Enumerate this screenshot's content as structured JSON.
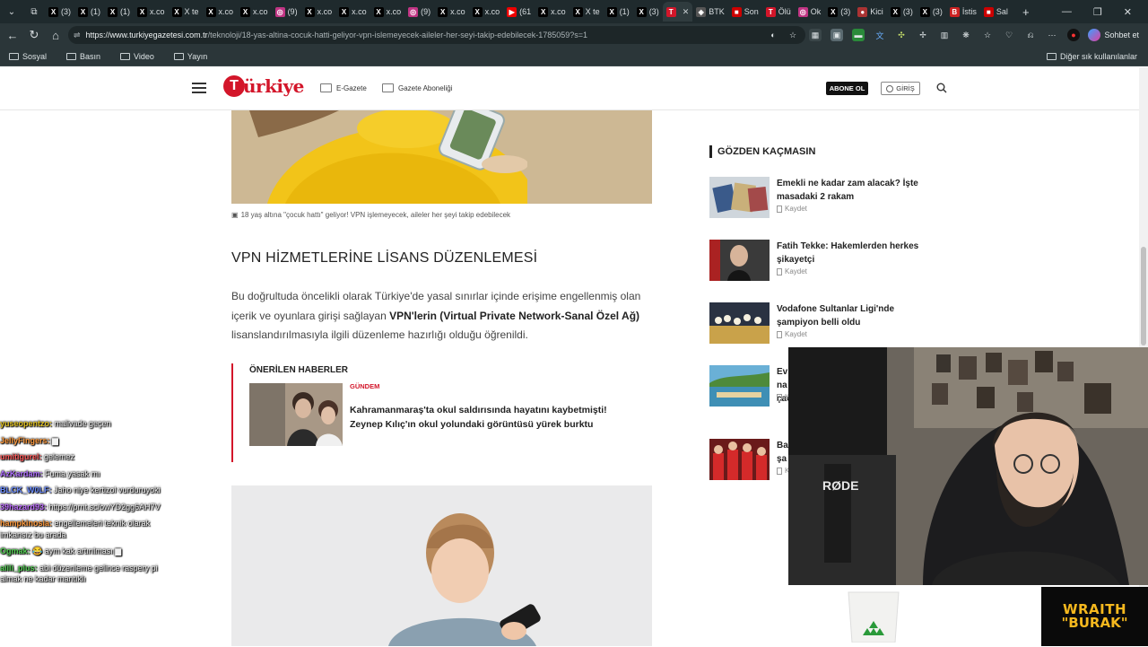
{
  "browser": {
    "tabs": [
      {
        "label": "(3)",
        "fav": "X",
        "color": "#000"
      },
      {
        "label": "(1)",
        "fav": "X",
        "color": "#000"
      },
      {
        "label": "(1)",
        "fav": "X",
        "color": "#000"
      },
      {
        "label": "x.co",
        "fav": "X",
        "color": "#000"
      },
      {
        "label": "X te",
        "fav": "X",
        "color": "#000"
      },
      {
        "label": "x.co",
        "fav": "X",
        "color": "#000"
      },
      {
        "label": "x.co",
        "fav": "X",
        "color": "#000"
      },
      {
        "label": "(9)",
        "fav": "◎",
        "color": "#c13584"
      },
      {
        "label": "x.co",
        "fav": "X",
        "color": "#000"
      },
      {
        "label": "x.co",
        "fav": "X",
        "color": "#000"
      },
      {
        "label": "x.co",
        "fav": "X",
        "color": "#000"
      },
      {
        "label": "(9)",
        "fav": "◎",
        "color": "#c13584"
      },
      {
        "label": "x.co",
        "fav": "X",
        "color": "#000"
      },
      {
        "label": "x.co",
        "fav": "X",
        "color": "#000"
      },
      {
        "label": "(61",
        "fav": "▶",
        "color": "#e00"
      },
      {
        "label": "x.co",
        "fav": "X",
        "color": "#000"
      },
      {
        "label": "X te",
        "fav": "X",
        "color": "#000"
      },
      {
        "label": "(1)",
        "fav": "X",
        "color": "#000"
      },
      {
        "label": "(3)",
        "fav": "X",
        "color": "#000"
      },
      {
        "label": "",
        "fav": "T",
        "color": "#d3162a",
        "active": true
      },
      {
        "label": "BTK",
        "fav": "◈",
        "color": "#555"
      },
      {
        "label": "Son",
        "fav": "■",
        "color": "#c00"
      },
      {
        "label": "Ölü",
        "fav": "T",
        "color": "#d3162a"
      },
      {
        "label": "Ok",
        "fav": "◎",
        "color": "#c13584"
      },
      {
        "label": "(3)",
        "fav": "X",
        "color": "#000"
      },
      {
        "label": "Kici",
        "fav": "●",
        "color": "#a33"
      },
      {
        "label": "(3)",
        "fav": "X",
        "color": "#000"
      },
      {
        "label": "(3)",
        "fav": "X",
        "color": "#000"
      },
      {
        "label": "İstis",
        "fav": "B",
        "color": "#c22"
      },
      {
        "label": "Sal",
        "fav": "■",
        "color": "#c00"
      }
    ],
    "url_host": "https://www.turkiyegazetesi.com.tr",
    "url_path": "/teknoloji/18-yas-altina-cocuk-hatti-geliyor-vpn-islemeyecek-aileler-her-seyi-takip-edebilecek-1785059?s=1",
    "sohbet_label": "Sohbet et",
    "bookmarks": [
      "Sosyal",
      "Basın",
      "Video",
      "Yayın"
    ],
    "other_bookmarks": "Diğer sık kullanılanlar"
  },
  "site": {
    "logo_text": "ürkiye",
    "logo_mark": "T",
    "egazete": "E-Gazete",
    "abonelik": "Gazete Aboneliği",
    "abone_button": "ABONE OL",
    "giris_button": "GİRİŞ"
  },
  "article": {
    "caption": "18 yaş altına \"çocuk hattı\" geliyor! VPN işlemeyecek, aileler her şeyi takip edebilecek",
    "section_heading": "VPN HİZMETLERİNE LİSANS DÜZENLEMESİ",
    "para_before": "Bu doğrultuda öncelikli olarak Türkiye'de yasal sınırlar içinde erişime engellenmiş olan içerik ve oyunlara girişi sağlayan ",
    "para_bold": "VPN'lerin (Virtual Private Network-Sanal Özel Ağ)",
    "para_after": " lisanslandırılmasıyla ilgili düzenleme hazırlığı olduğu öğrenildi.",
    "recommended": {
      "title": "ÖNERİLEN HABERLER",
      "category": "GÜNDEM",
      "headline": "Kahramanmaraş'ta okul saldırısında hayatını kaybetmişti! Zeynep Kılıç'ın okul yolundaki görüntüsü yürek burktu"
    }
  },
  "sidebar": {
    "title": "GÖZDEN KAÇMASIN",
    "save_label": "Kaydet",
    "items": [
      {
        "title": "Emekli ne kadar zam alacak? İşte masadaki 2 rakam"
      },
      {
        "title": "Fatih Tekke: Hakemlerden herkes şikayetçi"
      },
      {
        "title": "Vodafone Sultanlar Ligi'nde şampiyon belli oldu"
      },
      {
        "title": "Ev\nna\nçaç"
      },
      {
        "title": "Ba\nşa"
      }
    ]
  },
  "chat": [
    {
      "user": "yuseopentzo:",
      "msg": "malivade geçen",
      "color": "#e0c020"
    },
    {
      "user": "JellyFingers:",
      "msg": "▆",
      "color": "#ff9a3c"
    },
    {
      "user": "umitigurel:",
      "msg": "gelemez",
      "color": "#ff5a5a"
    },
    {
      "user": "AzKardam:",
      "msg": "Fuma yasak mı",
      "color": "#b070ff"
    },
    {
      "user": "BLCK_W0LF:",
      "msg": "Jaho niye kertizol vurduruyoki",
      "color": "#6b8cff"
    },
    {
      "user": "39hazard93:",
      "msg": "https://prnt.sc/owYD2gg6AH7V",
      "color": "#c070ff"
    },
    {
      "user": "hampkinosia:",
      "msg": "engellemeleri teknik olarak imkansız bu arada",
      "color": "#ff9a3c"
    },
    {
      "user": "Ogmak:",
      "msg": "😂 aym kak artırılması ▆",
      "color": "#55d055"
    },
    {
      "user": "alili_plus:",
      "msg": "abi düzenleme gelince raspery pi almak ne kadar mantıklı",
      "color": "#55d055"
    }
  ],
  "stream": {
    "brand_line1": "WRAITH",
    "brand_line2": "\"BURAK\""
  }
}
